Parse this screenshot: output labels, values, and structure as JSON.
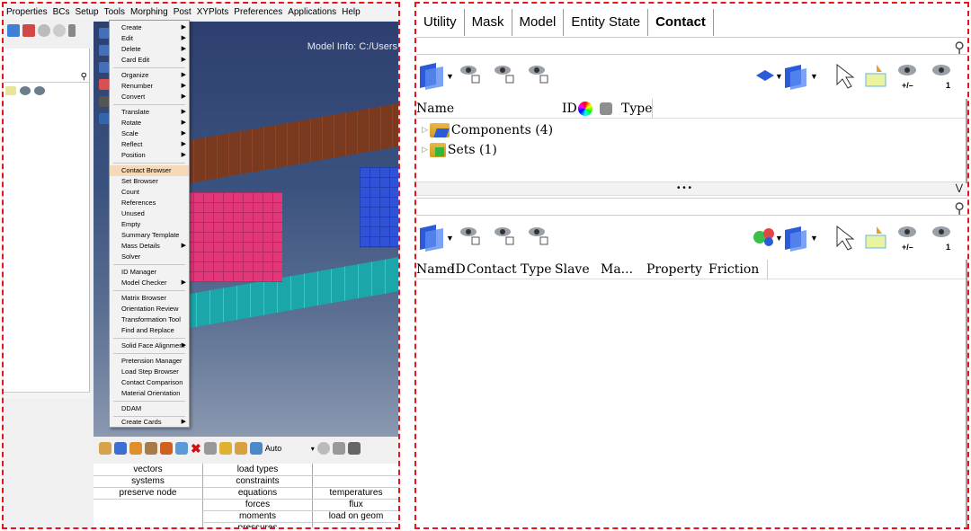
{
  "left": {
    "menubar": [
      "Properties",
      "BCs",
      "Setup",
      "Tools",
      "Morphing",
      "Post",
      "XYPlots",
      "Preferences",
      "Applications",
      "Help"
    ],
    "model_info": "Model Info: C:/Users",
    "tools_menu": [
      {
        "label": "Create",
        "arrow": "▶"
      },
      {
        "label": "Edit",
        "arrow": "▶"
      },
      {
        "label": "Delete",
        "arrow": "▶"
      },
      {
        "label": "Card Edit",
        "arrow": "▶"
      },
      {
        "label": "Organize",
        "arrow": "▶"
      },
      {
        "label": "Renumber",
        "arrow": "▶"
      },
      {
        "label": "Convert",
        "arrow": "▶"
      },
      {
        "label": "Translate",
        "arrow": "▶"
      },
      {
        "label": "Rotate",
        "arrow": "▶"
      },
      {
        "label": "Scale",
        "arrow": "▶"
      },
      {
        "label": "Reflect",
        "arrow": "▶"
      },
      {
        "label": "Position",
        "arrow": "▶"
      },
      {
        "label": "Contact Browser",
        "arrow": ""
      },
      {
        "label": "Set Browser",
        "arrow": ""
      },
      {
        "label": "Count",
        "arrow": ""
      },
      {
        "label": "References",
        "arrow": ""
      },
      {
        "label": "Unused",
        "arrow": ""
      },
      {
        "label": "Empty",
        "arrow": ""
      },
      {
        "label": "Summary Template",
        "arrow": ""
      },
      {
        "label": "Mass Details",
        "arrow": "▶"
      },
      {
        "label": "Solver",
        "arrow": ""
      },
      {
        "label": "ID Manager",
        "arrow": ""
      },
      {
        "label": "Model Checker",
        "arrow": "▶"
      },
      {
        "label": "Matrix Browser",
        "arrow": ""
      },
      {
        "label": "Orientation Review",
        "arrow": ""
      },
      {
        "label": "Transformation Tool",
        "arrow": ""
      },
      {
        "label": "Find and Replace",
        "arrow": ""
      },
      {
        "label": "Solid Face Alignment",
        "arrow": "▶"
      },
      {
        "label": "Pretension Manager",
        "arrow": ""
      },
      {
        "label": "Load Step Browser",
        "arrow": ""
      },
      {
        "label": "Contact Comparison",
        "arrow": ""
      },
      {
        "label": "Material Orientation",
        "arrow": ""
      },
      {
        "label": "DDAM",
        "arrow": ""
      },
      {
        "label": "Create Cards",
        "arrow": "▶"
      }
    ],
    "bottom_toolbar_auto": "Auto",
    "bc_table": {
      "col1": [
        "vectors",
        "systems",
        "preserve node"
      ],
      "col2": [
        "load types",
        "constraints",
        "equations",
        "forces",
        "moments",
        "pressures"
      ],
      "col3": [
        "temperatures",
        "flux",
        "load on geom"
      ]
    }
  },
  "right": {
    "tabs": [
      "Utility",
      "Mask",
      "Model",
      "Entity State",
      "Contact"
    ],
    "upper_columns": [
      "Name",
      "ID",
      "Type"
    ],
    "tree": [
      {
        "label": "Components (4)"
      },
      {
        "label": "Sets (1)"
      }
    ],
    "splitter_dots": "• • •",
    "lower_columns": [
      "Name",
      "ID",
      "Contact Type",
      "Slave",
      "Ma...",
      "Property",
      "Friction"
    ],
    "eye_plusminus": "+/–",
    "eye_one": "1"
  },
  "colors": {
    "border_dash": "#e8141b",
    "menu_highlight": "#f5d9b8",
    "beam_brown": "#7a3a20",
    "beam_cyan": "#1ba6a9",
    "box_pink": "#e2387a",
    "box_blue": "#2f52d8"
  }
}
